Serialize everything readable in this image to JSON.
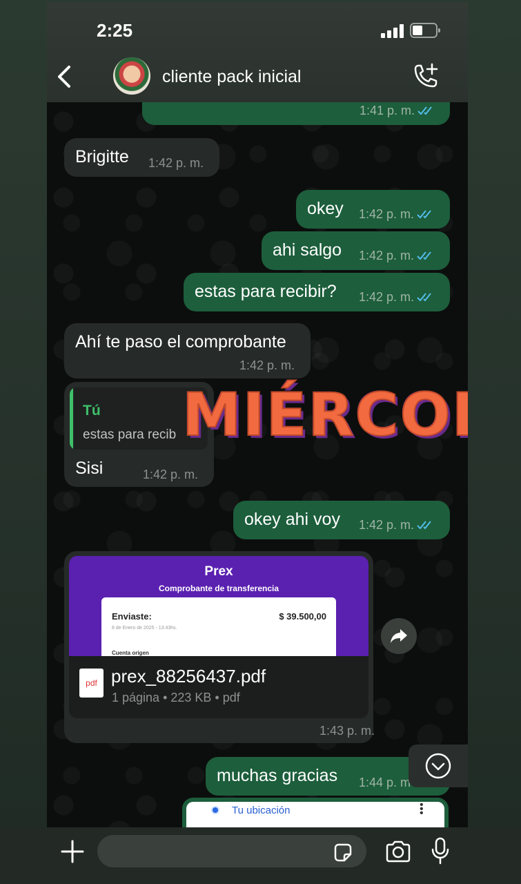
{
  "status_bar": {
    "time": "2:25"
  },
  "header": {
    "contact_name": "cliente pack inicial"
  },
  "messages": [
    {
      "dir": "out",
      "text": "",
      "time": "1:41 p. m."
    },
    {
      "dir": "in",
      "text": "Brigitte",
      "time": "1:42 p. m."
    },
    {
      "dir": "out",
      "text": "okey",
      "time": "1:42 p. m."
    },
    {
      "dir": "out",
      "text": "ahi salgo",
      "time": "1:42 p. m."
    },
    {
      "dir": "out",
      "text": "estas para recibir?",
      "time": "1:42 p. m."
    },
    {
      "dir": "in",
      "text": "Ahí te paso el comprobante",
      "time": "1:42 p. m."
    },
    {
      "dir": "in",
      "text": "Sisi",
      "time": "1:42 p. m.",
      "quote": {
        "author": "Tú",
        "text": "estas para recib"
      }
    },
    {
      "dir": "out",
      "text": "okey ahi voy",
      "time": "1:42 p. m."
    },
    {
      "dir": "out",
      "text": "muchas gracias",
      "time": "1:44 p. m"
    }
  ],
  "sticker_text": "MIÉRCOLES",
  "file_message": {
    "preview": {
      "brand": "Prex",
      "title": "Comprobante de transferencia",
      "sent_label": "Enviaste:",
      "amount": "$ 39.500,00",
      "date": "8 de Enero de 2025 - 13:43hs.",
      "origin_label": "Cuenta origen"
    },
    "icon_label": "pdf",
    "file_name": "prex_88256437.pdf",
    "file_info": "1 página • 223 KB • pdf",
    "time": "1:43 p. m."
  },
  "location_label": "Tu ubicación",
  "input": {
    "placeholder": ""
  },
  "colors": {
    "outgoing_bubble": "#1d5e3c",
    "incoming_bubble": "#262a28",
    "ticks": "#53bdeb",
    "quote_accent": "#3fbf6a"
  }
}
